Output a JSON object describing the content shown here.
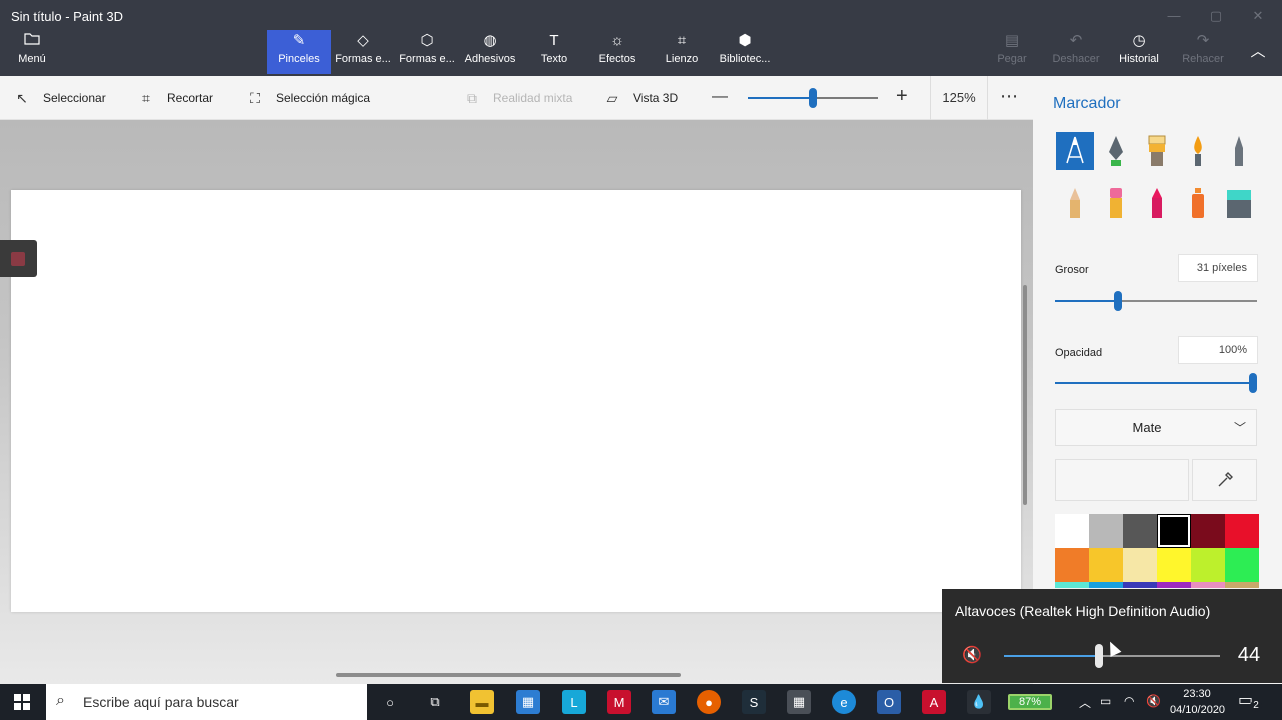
{
  "window": {
    "title": "Sin título - Paint 3D"
  },
  "ribbon": {
    "menu": "Menú",
    "tabs": [
      {
        "label": "Pinceles",
        "icon": "brush-icon",
        "active": true
      },
      {
        "label": "Formas e...",
        "icon": "2d-shapes-icon"
      },
      {
        "label": "Formas e...",
        "icon": "3d-shapes-icon"
      },
      {
        "label": "Adhesivos",
        "icon": "sticker-icon"
      },
      {
        "label": "Texto",
        "icon": "text-icon"
      },
      {
        "label": "Efectos",
        "icon": "effects-icon"
      },
      {
        "label": "Lienzo",
        "icon": "canvas-icon"
      },
      {
        "label": "Bibliotec...",
        "icon": "3d-library-icon"
      }
    ],
    "right": [
      {
        "label": "Pegar",
        "icon": "paste-icon",
        "enabled": false
      },
      {
        "label": "Deshacer",
        "icon": "undo-icon",
        "enabled": false
      },
      {
        "label": "Historial",
        "icon": "history-icon",
        "enabled": true
      },
      {
        "label": "Rehacer",
        "icon": "redo-icon",
        "enabled": false
      }
    ]
  },
  "toolbar": {
    "select": "Seleccionar",
    "crop": "Recortar",
    "magic_select": "Selección mágica",
    "mixed_reality": "Realidad mixta",
    "view3d": "Vista 3D",
    "zoom_percent": "125%",
    "zoom_level": 0.5
  },
  "panel": {
    "title": "Marcador",
    "thickness_label": "Grosor",
    "thickness_value": "31 píxeles",
    "thickness_level": 0.31,
    "opacity_label": "Opacidad",
    "opacity_value": "100%",
    "opacity_level": 1.0,
    "finish": "Mate",
    "brushes": [
      "marker",
      "calligraphy-pen",
      "oil-brush",
      "watercolor",
      "pixel-pen",
      "pencil",
      "eraser",
      "crayon",
      "spray-can",
      "fill"
    ],
    "palette": [
      "#ffffff",
      "#b8b8b8",
      "#575757",
      "#000000",
      "#7a0b1c",
      "#e8102a",
      "#f07c28",
      "#f7c62a",
      "#f6e7a6",
      "#fff62c",
      "#bdf02c",
      "#2ded54",
      "#5ce7d5",
      "#1aa0e0",
      "#3a3ab8",
      "#9e2bc0",
      "#e88ec0",
      "#c8a86a"
    ]
  },
  "volume": {
    "device": "Altavoces (Realtek High Definition Audio)",
    "value": "44",
    "level": 0.44
  },
  "taskbar": {
    "search_placeholder": "Escribe aquí para buscar",
    "battery": "87%",
    "time": "23:30",
    "date": "04/10/2020",
    "notifications": "2"
  }
}
